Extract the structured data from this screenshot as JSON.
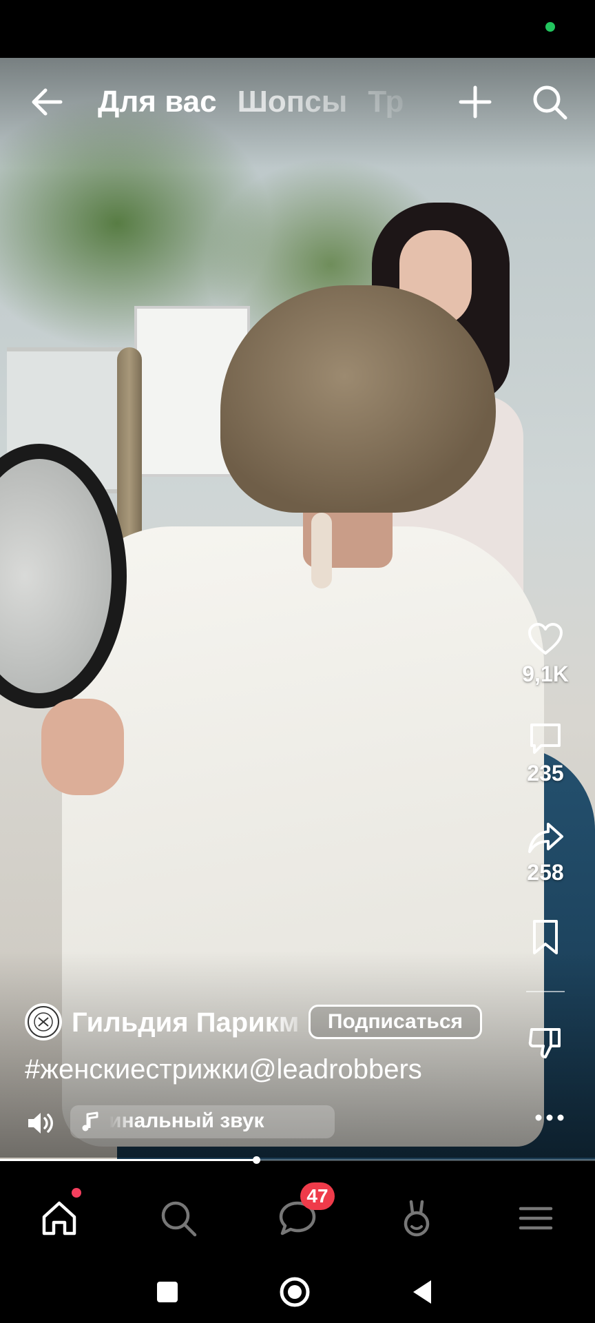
{
  "top_nav": {
    "tabs": [
      {
        "label": "Для вас",
        "active": true
      },
      {
        "label": "Шопсы",
        "active": false
      },
      {
        "label": "Тр",
        "active": false
      }
    ]
  },
  "actions": {
    "likes": "9,1K",
    "comments": "235",
    "shares": "258"
  },
  "post": {
    "author": "Гильдия Парикм",
    "subscribe_label": "Подписаться",
    "hashtags": "#женскиестрижки@leadrobbers",
    "audio": "инальный звук",
    "progress_fraction": 0.43
  },
  "bottom_nav": {
    "messages_badge": "47"
  },
  "colors": {
    "accent_red": "#ef3b4a",
    "status_green": "#22c55e"
  },
  "icons": [
    "back-arrow-icon",
    "plus-icon",
    "search-icon",
    "heart-icon",
    "comment-icon",
    "share-icon",
    "bookmark-icon",
    "dislike-icon",
    "more-icon",
    "volume-icon",
    "music-note-icon",
    "home-icon",
    "chat-icon",
    "profile-icon",
    "menu-icon"
  ]
}
